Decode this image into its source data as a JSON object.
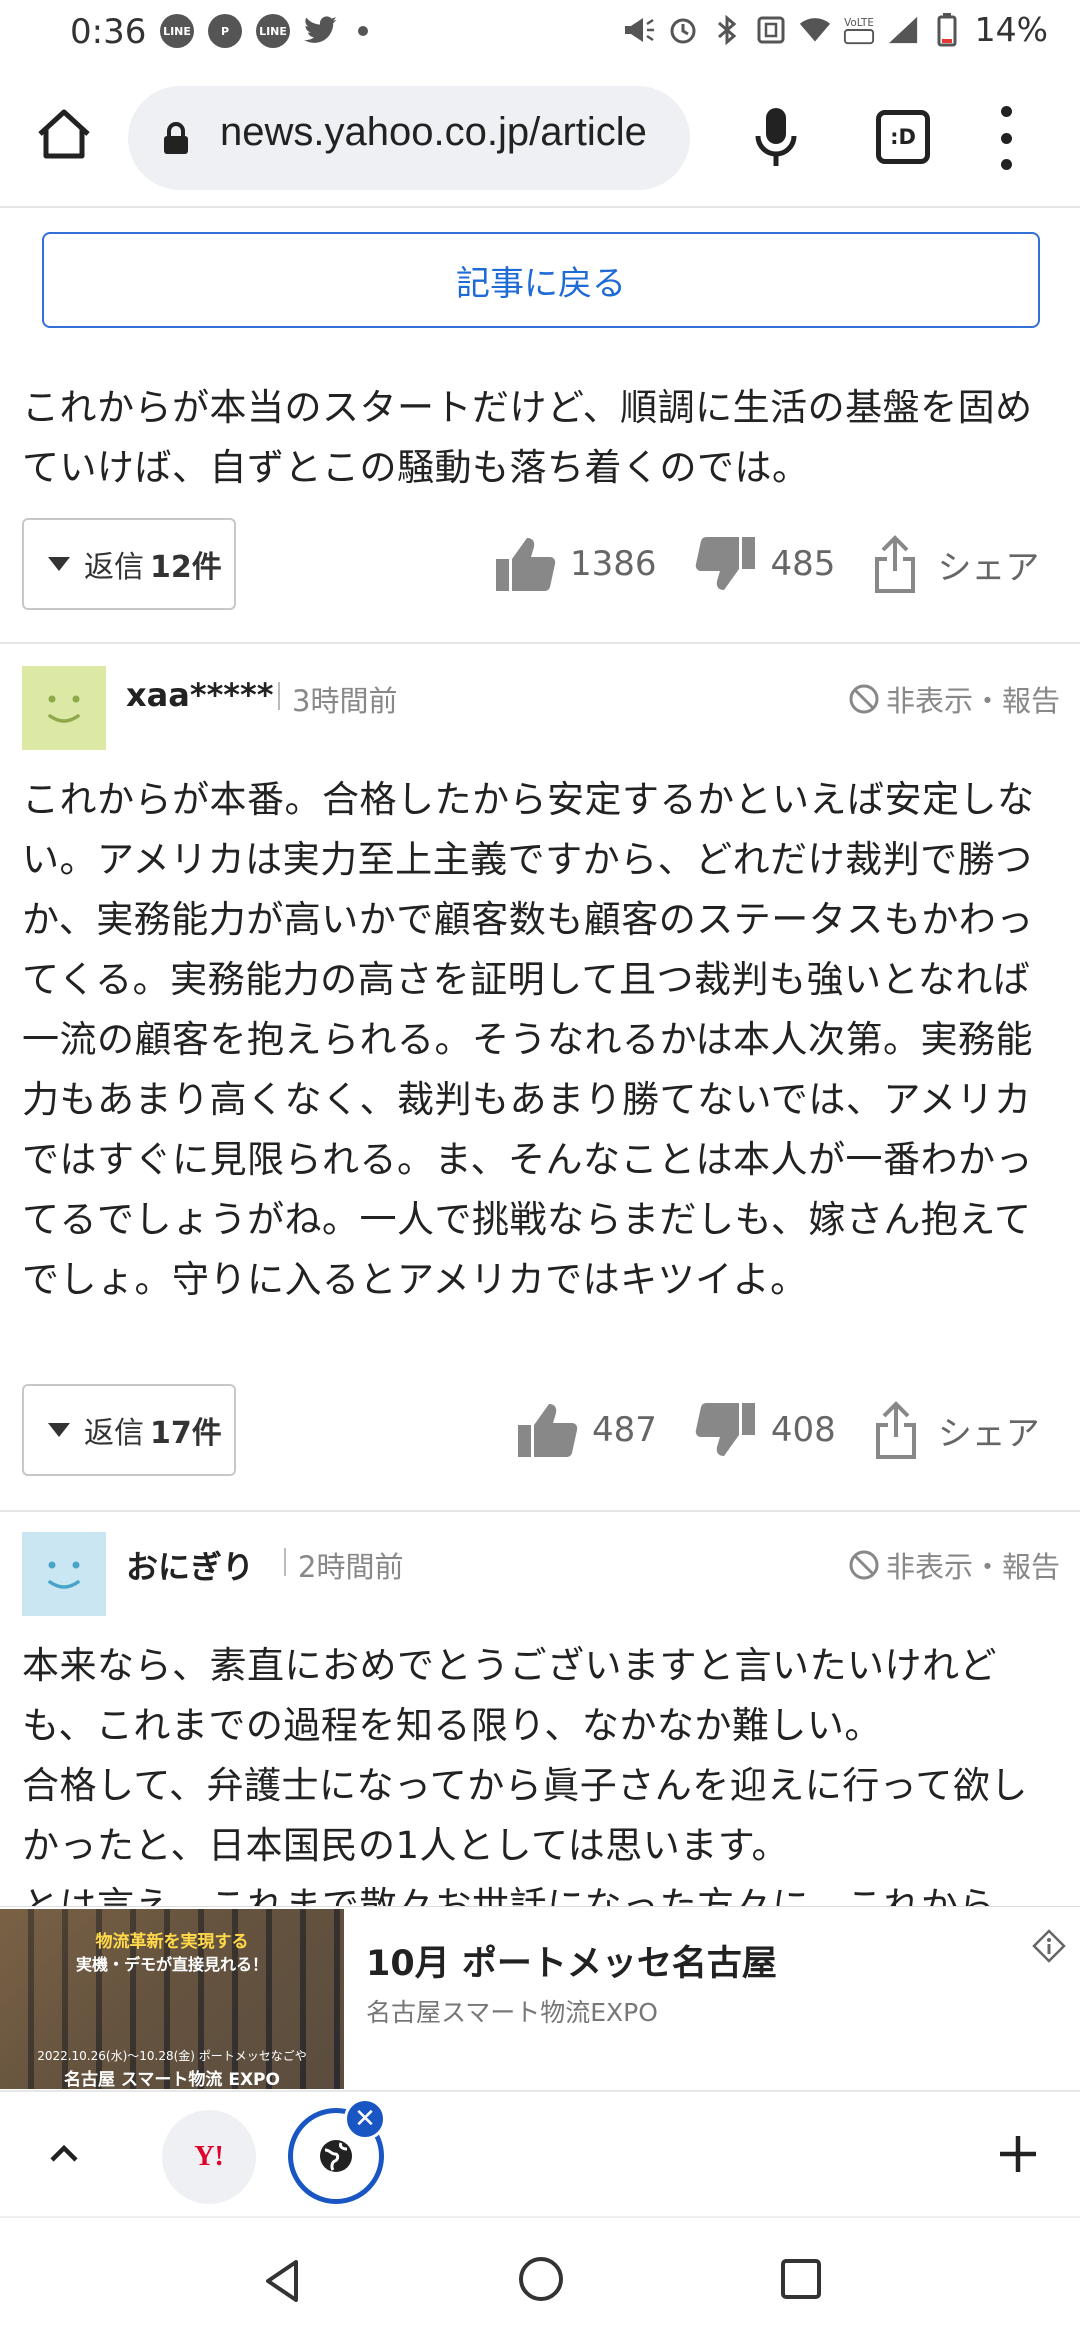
{
  "status_bar": {
    "time": "0:36",
    "left_icons": [
      "line-icon",
      "pinterest-icon",
      "line-icon",
      "twitter-icon"
    ],
    "battery": "14%"
  },
  "browser": {
    "url": "news.yahoo.co.jp/article",
    "tabs_label": ":D"
  },
  "back_button": "記事に戻る",
  "comments": [
    {
      "text": "これからが本当のスタートだけど、順調に生活の基盤を固めていけば、自ずとこの騒動も落ち着くのでは。",
      "reply_prefix": "返信",
      "reply_count": "12件",
      "likes": "1386",
      "dislikes": "485",
      "share": "シェア"
    },
    {
      "user": "xaa*****",
      "time": "3時間前",
      "report": "非表示・報告",
      "avatar_color": "#dbe9a4",
      "text": "これからが本番。合格したから安定するかといえば安定しない。アメリカは実力至上主義ですから、どれだけ裁判で勝つか、実務能力が高いかで顧客数も顧客のステータスもかわってくる。実務能力の高さを証明して且つ裁判も強いとなれば一流の顧客を抱えられる。そうなれるかは本人次第。実務能力もあまり高くなく、裁判もあまり勝てないでは、アメリカではすぐに見限られる。ま、そんなことは本人が一番わかってるでしょうがね。一人で挑戦ならまだしも、嫁さん抱えてでしょ。守りに入るとアメリカではキツイよ。",
      "reply_prefix": "返信",
      "reply_count": "17件",
      "likes": "487",
      "dislikes": "408",
      "share": "シェア"
    },
    {
      "user": "おにぎり",
      "time": "2時間前",
      "report": "非表示・報告",
      "avatar_color": "#c9e6f2",
      "text": "本来なら、素直におめでとうございますと言いたいけれども、これまでの過程を知る限り、なかなか難しい。\n合格して、弁護士になってから眞子さんを迎えに行って欲しかったと、日本国民の1人としては思います。\nとは言え、これまで散々お世話になった方々に、これから"
    }
  ],
  "ad": {
    "image_headline": "物流革新を実現する",
    "image_subline": "実機・デモが直接見れる！",
    "image_date": "2022.10.26(水)～10.28(金) ポートメッセなごや",
    "image_name": "名古屋 スマート物流 EXPO",
    "title": "10月 ポートメッセ名古屋",
    "sponsor": "名古屋スマート物流EXPO"
  },
  "tab_strip": {
    "yahoo_label": "Y!"
  }
}
